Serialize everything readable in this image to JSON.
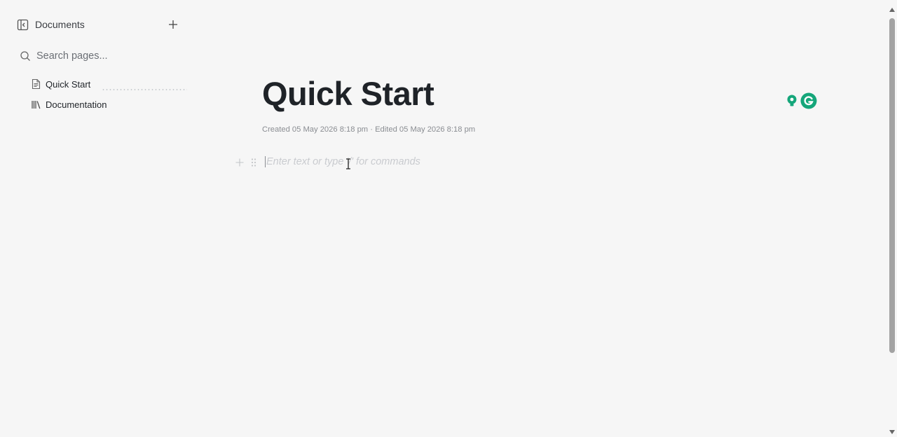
{
  "sidebar": {
    "title": "Documents",
    "search_placeholder": "Search pages...",
    "items": [
      {
        "label": "Quick Start",
        "icon": "document-icon"
      },
      {
        "label": "Documentation",
        "icon": "library-icon"
      }
    ]
  },
  "page": {
    "title": "Quick Start",
    "meta": "Created 05 May 2026 8:18 pm · Edited 05 May 2026 8:18 pm",
    "editor_placeholder": "Enter text or type '/' for commands"
  },
  "colors": {
    "background": "#f6f6f6",
    "text": "#1f2328",
    "muted": "#8a8d92",
    "extension_accent": "#15a67a"
  },
  "extensions": [
    {
      "icon": "lightbulb-icon"
    },
    {
      "icon": "grammarly-icon"
    }
  ]
}
